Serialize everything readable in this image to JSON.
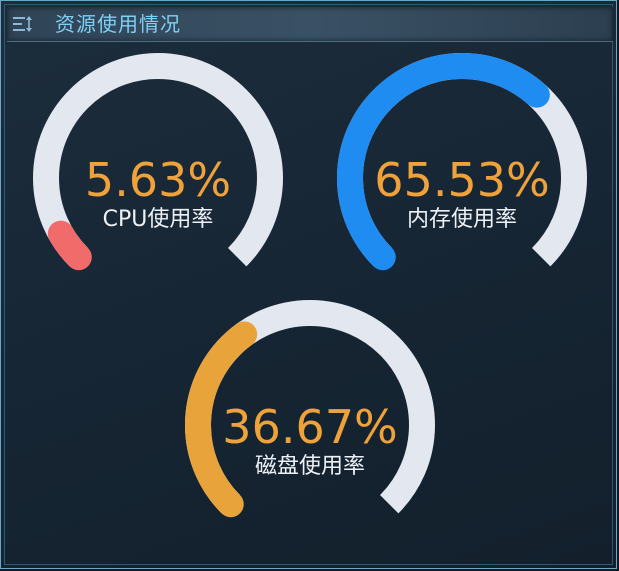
{
  "header": {
    "title": "资源使用情况",
    "icon": "list-sort-icon"
  },
  "colors": {
    "track": "#e3e7ef",
    "value_text": "#f0a23a",
    "label_text": "#eef2f6",
    "accent_title": "#7fd0f5"
  },
  "chart_data": [
    {
      "type": "gauge",
      "value": 5.63,
      "value_label": "5.63%",
      "label": "CPU使用率",
      "color": "#f26b6b",
      "min": 0,
      "max": 100
    },
    {
      "type": "gauge",
      "value": 65.53,
      "value_label": "65.53%",
      "label": "内存使用率",
      "color": "#1e8cf0",
      "min": 0,
      "max": 100
    },
    {
      "type": "gauge",
      "value": 36.67,
      "value_label": "36.67%",
      "label": "磁盘使用率",
      "color": "#e8a33b",
      "min": 0,
      "max": 100
    }
  ]
}
